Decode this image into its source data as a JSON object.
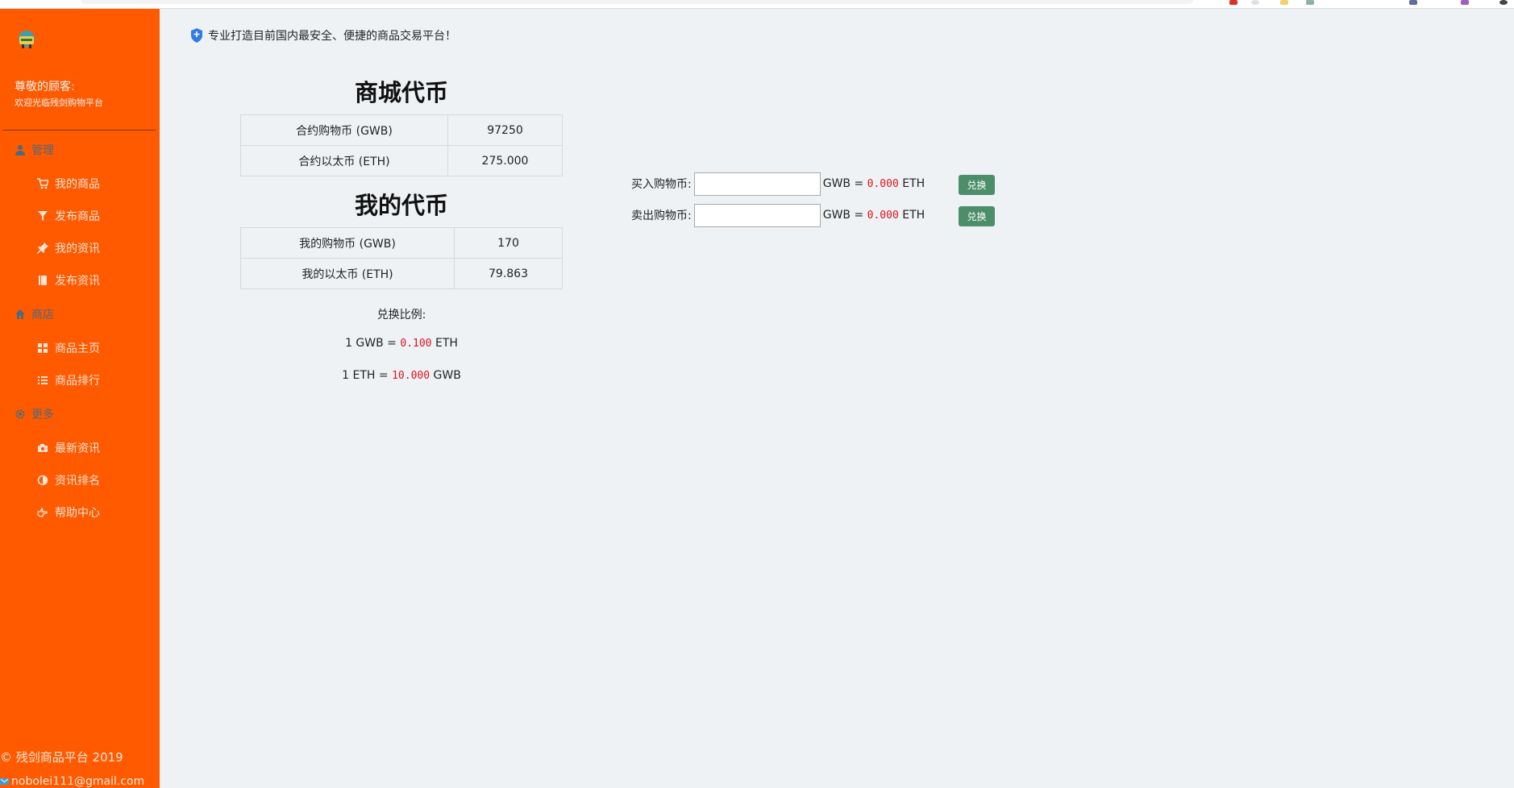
{
  "sidebar": {
    "greeting_title": "尊敬的顾客:",
    "greeting_sub": "欢迎光临残剑购物平台",
    "groups": [
      {
        "label": "管理",
        "icon": "user-icon",
        "items": [
          {
            "label": "我的商品",
            "icon": "cart-icon"
          },
          {
            "label": "发布商品",
            "icon": "filter-icon"
          },
          {
            "label": "我的资讯",
            "icon": "pin-icon"
          },
          {
            "label": "发布资讯",
            "icon": "book-icon"
          }
        ]
      },
      {
        "label": "商店",
        "icon": "home-icon",
        "items": [
          {
            "label": "商品主页",
            "icon": "grid-icon"
          },
          {
            "label": "商品排行",
            "icon": "list-icon"
          }
        ]
      },
      {
        "label": "更多",
        "icon": "gear-icon",
        "items": [
          {
            "label": "最新资讯",
            "icon": "camera-icon"
          },
          {
            "label": "资讯排名",
            "icon": "contrast-icon"
          },
          {
            "label": "帮助中心",
            "icon": "hand-point-icon"
          }
        ]
      }
    ],
    "footer_copyright": "© 残剑商品平台 2019",
    "footer_email": "nobolei111@gmail.com"
  },
  "header": {
    "slogan": "专业打造目前国内最安全、便捷的商品交易平台！"
  },
  "mall_tokens": {
    "title": "商城代币",
    "rows": [
      {
        "label": "合约购物币 (GWB)",
        "value": "97250"
      },
      {
        "label": "合约以太币 (ETH)",
        "value": "275.000"
      }
    ]
  },
  "my_tokens": {
    "title": "我的代币",
    "rows": [
      {
        "label": "我的购物币 (GWB)",
        "value": "170"
      },
      {
        "label": "我的以太币 (ETH)",
        "value": "79.863"
      }
    ]
  },
  "exchange_rate": {
    "label": "兑换比例:",
    "gwb_prefix": "1 GWB =",
    "gwb_value": "0.100",
    "gwb_suffix": "ETH",
    "eth_prefix": "1 ETH =",
    "eth_value": "10.000",
    "eth_suffix": "GWB"
  },
  "trade": {
    "buy": {
      "label": "买入购物币:",
      "input_value": "",
      "eq_prefix": "GWB =",
      "amount": "0.000",
      "eq_suffix": "ETH",
      "button": "兑换"
    },
    "sell": {
      "label": "卖出购物币:",
      "input_value": "",
      "eq_prefix": "GWB =",
      "amount": "0.000",
      "eq_suffix": "ETH",
      "button": "兑换"
    }
  },
  "colors": {
    "sidebar_bg": "#ff5a00",
    "page_bg": "#eef2f5",
    "button_bg": "#4c8d6a",
    "highlight_red": "#e0141e"
  }
}
